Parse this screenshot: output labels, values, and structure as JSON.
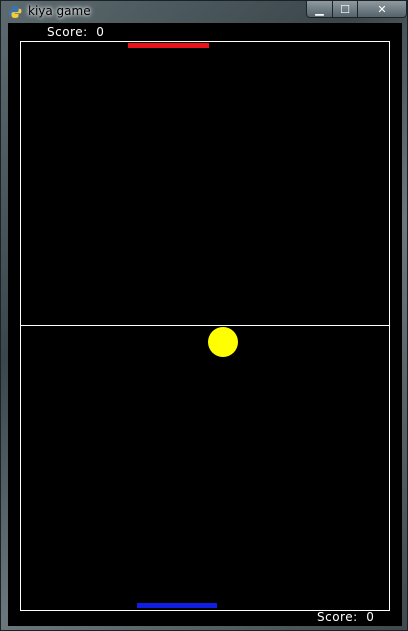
{
  "window": {
    "title": "kiya game",
    "controls": {
      "minimize": "▁",
      "maximize": "☐",
      "close": "✕"
    },
    "icon": "python-icon"
  },
  "game": {
    "top_player": {
      "label": "Score:",
      "score": "0",
      "paddle_color": "#e8141c"
    },
    "bottom_player": {
      "label": "Score:",
      "score": "0",
      "paddle_color": "#0f1ee0"
    },
    "ball_color": "#ffff00",
    "background_color": "#000000",
    "line_color": "#ffffff"
  }
}
